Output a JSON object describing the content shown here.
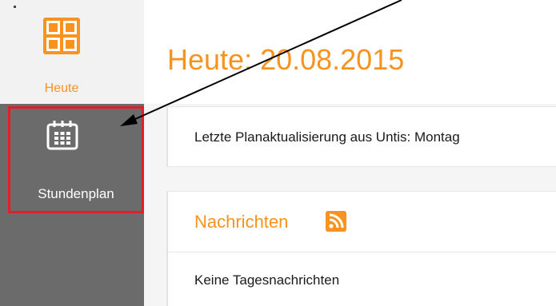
{
  "sidebar": {
    "today_label": "Heute",
    "timetable_label": "Stundenplan"
  },
  "main": {
    "page_title": "Heute: 20.08.2015",
    "update_text": "Letzte Planaktualisierung aus Untis: Montag",
    "news_title": "Nachrichten",
    "news_empty": "Keine Tagesnachrichten"
  },
  "colors": {
    "accent": "#f7931e",
    "sidebar_dark": "#6b6b6b",
    "highlight_border": "#e01f26",
    "annotation_arrow": "#000000"
  },
  "icons": {
    "today": "grid-icon",
    "timetable": "calendar-icon",
    "news_feed": "rss-icon"
  }
}
